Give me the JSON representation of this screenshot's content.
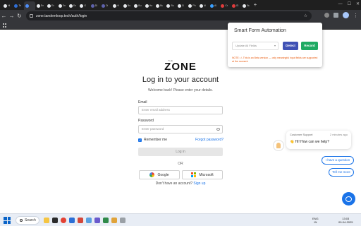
{
  "browser": {
    "tabs": [
      {
        "label": "Hi",
        "color": "#e8eaed"
      },
      {
        "label": "Te",
        "color": "#2f6fd6"
      },
      {
        "label": "",
        "color": "#4e8ef7",
        "active": true
      },
      {
        "label": "En",
        "color": "#e8eaed"
      },
      {
        "label": "En",
        "color": "#e8eaed"
      },
      {
        "label": "En",
        "color": "#e8eaed"
      },
      {
        "label": "En",
        "color": "#e8eaed"
      },
      {
        "label": "G",
        "color": "#e8eaed"
      },
      {
        "label": "Di",
        "color": "#5f63ad"
      },
      {
        "label": "Di",
        "color": "#5f63ad"
      },
      {
        "label": "Hi",
        "color": "#e8eaed"
      },
      {
        "label": "Bu",
        "color": "#e8eaed"
      },
      {
        "label": "Bu",
        "color": "#e8eaed"
      },
      {
        "label": "Ha",
        "color": "#e8eaed"
      },
      {
        "label": "Bu",
        "color": "#e8eaed"
      },
      {
        "label": "Bu",
        "color": "#e8eaed"
      },
      {
        "label": "Gi",
        "color": "#e8eaed"
      },
      {
        "label": "Ph",
        "color": "#e8eaed"
      },
      {
        "label": "AI",
        "color": "#e8eaed"
      },
      {
        "label": "AI",
        "color": "#3aa0ff"
      },
      {
        "label": "Cr",
        "color": "#e03c3c"
      },
      {
        "label": "Gi",
        "color": "#e03c3c"
      },
      {
        "label": "Bu",
        "color": "#e8eaed"
      }
    ],
    "new_tab_glyph": "+",
    "window_controls": {
      "minimize": "—",
      "maximize": "☐",
      "close": "✕"
    },
    "url": "zone.tandemloop.tech/auth/login",
    "nav": {
      "back": "←",
      "forward": "→",
      "reload": "↻"
    },
    "star_glyph": "☆",
    "kebab_glyph": "⋮"
  },
  "login": {
    "logo_small": "THE",
    "logo": "ZONE",
    "heading": "Log in to your account",
    "subheading": "Welcome back! Please enter your details.",
    "email_label": "Email",
    "email_placeholder": "Enter email address",
    "password_label": "Password",
    "password_placeholder": "Enter password",
    "remember_label": "Remember me",
    "remember_checked": true,
    "forgot_label": "Forgot password?",
    "login_button": "Log in",
    "or_text": "OR",
    "google_label": "Google",
    "microsoft_label": "Microsoft",
    "no_account_text": "Don't have an account?",
    "signup_link": "Sign up"
  },
  "extension_popup": {
    "title": "Smart Form Automation",
    "select_value": "Update All Fields",
    "detect_button": "Detect",
    "record_button": "Record",
    "note": "NOTE: ⚠ This is an Beta version — only meaningful input fields are supported at the moment.",
    "colors": {
      "detect": "#3f51b5",
      "record": "#1faa63",
      "note": "#e8590c"
    }
  },
  "chat": {
    "agent_name": "Customer Support",
    "time": "2 minutes ago",
    "message": "👋 Hi! How can we help?",
    "quick_replies": [
      "I have a question",
      "Tell me more"
    ]
  },
  "taskbar": {
    "search_label": "Search",
    "tray_lang": "ENG",
    "tray_region": "IN",
    "time": "13:03",
    "date": "09-04-2025"
  }
}
